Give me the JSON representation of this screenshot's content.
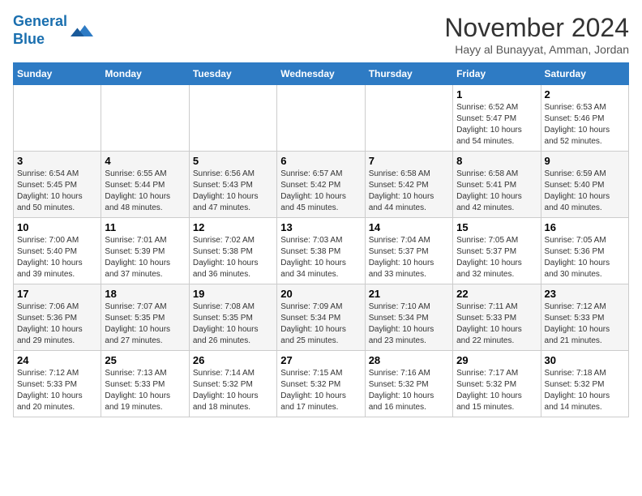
{
  "logo": {
    "line1": "General",
    "line2": "Blue"
  },
  "title": "November 2024",
  "subtitle": "Hayy al Bunayyat, Amman, Jordan",
  "days_of_week": [
    "Sunday",
    "Monday",
    "Tuesday",
    "Wednesday",
    "Thursday",
    "Friday",
    "Saturday"
  ],
  "weeks": [
    [
      {
        "day": "",
        "info": ""
      },
      {
        "day": "",
        "info": ""
      },
      {
        "day": "",
        "info": ""
      },
      {
        "day": "",
        "info": ""
      },
      {
        "day": "",
        "info": ""
      },
      {
        "day": "1",
        "info": "Sunrise: 6:52 AM\nSunset: 5:47 PM\nDaylight: 10 hours\nand 54 minutes."
      },
      {
        "day": "2",
        "info": "Sunrise: 6:53 AM\nSunset: 5:46 PM\nDaylight: 10 hours\nand 52 minutes."
      }
    ],
    [
      {
        "day": "3",
        "info": "Sunrise: 6:54 AM\nSunset: 5:45 PM\nDaylight: 10 hours\nand 50 minutes."
      },
      {
        "day": "4",
        "info": "Sunrise: 6:55 AM\nSunset: 5:44 PM\nDaylight: 10 hours\nand 48 minutes."
      },
      {
        "day": "5",
        "info": "Sunrise: 6:56 AM\nSunset: 5:43 PM\nDaylight: 10 hours\nand 47 minutes."
      },
      {
        "day": "6",
        "info": "Sunrise: 6:57 AM\nSunset: 5:42 PM\nDaylight: 10 hours\nand 45 minutes."
      },
      {
        "day": "7",
        "info": "Sunrise: 6:58 AM\nSunset: 5:42 PM\nDaylight: 10 hours\nand 44 minutes."
      },
      {
        "day": "8",
        "info": "Sunrise: 6:58 AM\nSunset: 5:41 PM\nDaylight: 10 hours\nand 42 minutes."
      },
      {
        "day": "9",
        "info": "Sunrise: 6:59 AM\nSunset: 5:40 PM\nDaylight: 10 hours\nand 40 minutes."
      }
    ],
    [
      {
        "day": "10",
        "info": "Sunrise: 7:00 AM\nSunset: 5:40 PM\nDaylight: 10 hours\nand 39 minutes."
      },
      {
        "day": "11",
        "info": "Sunrise: 7:01 AM\nSunset: 5:39 PM\nDaylight: 10 hours\nand 37 minutes."
      },
      {
        "day": "12",
        "info": "Sunrise: 7:02 AM\nSunset: 5:38 PM\nDaylight: 10 hours\nand 36 minutes."
      },
      {
        "day": "13",
        "info": "Sunrise: 7:03 AM\nSunset: 5:38 PM\nDaylight: 10 hours\nand 34 minutes."
      },
      {
        "day": "14",
        "info": "Sunrise: 7:04 AM\nSunset: 5:37 PM\nDaylight: 10 hours\nand 33 minutes."
      },
      {
        "day": "15",
        "info": "Sunrise: 7:05 AM\nSunset: 5:37 PM\nDaylight: 10 hours\nand 32 minutes."
      },
      {
        "day": "16",
        "info": "Sunrise: 7:05 AM\nSunset: 5:36 PM\nDaylight: 10 hours\nand 30 minutes."
      }
    ],
    [
      {
        "day": "17",
        "info": "Sunrise: 7:06 AM\nSunset: 5:36 PM\nDaylight: 10 hours\nand 29 minutes."
      },
      {
        "day": "18",
        "info": "Sunrise: 7:07 AM\nSunset: 5:35 PM\nDaylight: 10 hours\nand 27 minutes."
      },
      {
        "day": "19",
        "info": "Sunrise: 7:08 AM\nSunset: 5:35 PM\nDaylight: 10 hours\nand 26 minutes."
      },
      {
        "day": "20",
        "info": "Sunrise: 7:09 AM\nSunset: 5:34 PM\nDaylight: 10 hours\nand 25 minutes."
      },
      {
        "day": "21",
        "info": "Sunrise: 7:10 AM\nSunset: 5:34 PM\nDaylight: 10 hours\nand 23 minutes."
      },
      {
        "day": "22",
        "info": "Sunrise: 7:11 AM\nSunset: 5:33 PM\nDaylight: 10 hours\nand 22 minutes."
      },
      {
        "day": "23",
        "info": "Sunrise: 7:12 AM\nSunset: 5:33 PM\nDaylight: 10 hours\nand 21 minutes."
      }
    ],
    [
      {
        "day": "24",
        "info": "Sunrise: 7:12 AM\nSunset: 5:33 PM\nDaylight: 10 hours\nand 20 minutes."
      },
      {
        "day": "25",
        "info": "Sunrise: 7:13 AM\nSunset: 5:33 PM\nDaylight: 10 hours\nand 19 minutes."
      },
      {
        "day": "26",
        "info": "Sunrise: 7:14 AM\nSunset: 5:32 PM\nDaylight: 10 hours\nand 18 minutes."
      },
      {
        "day": "27",
        "info": "Sunrise: 7:15 AM\nSunset: 5:32 PM\nDaylight: 10 hours\nand 17 minutes."
      },
      {
        "day": "28",
        "info": "Sunrise: 7:16 AM\nSunset: 5:32 PM\nDaylight: 10 hours\nand 16 minutes."
      },
      {
        "day": "29",
        "info": "Sunrise: 7:17 AM\nSunset: 5:32 PM\nDaylight: 10 hours\nand 15 minutes."
      },
      {
        "day": "30",
        "info": "Sunrise: 7:18 AM\nSunset: 5:32 PM\nDaylight: 10 hours\nand 14 minutes."
      }
    ]
  ]
}
